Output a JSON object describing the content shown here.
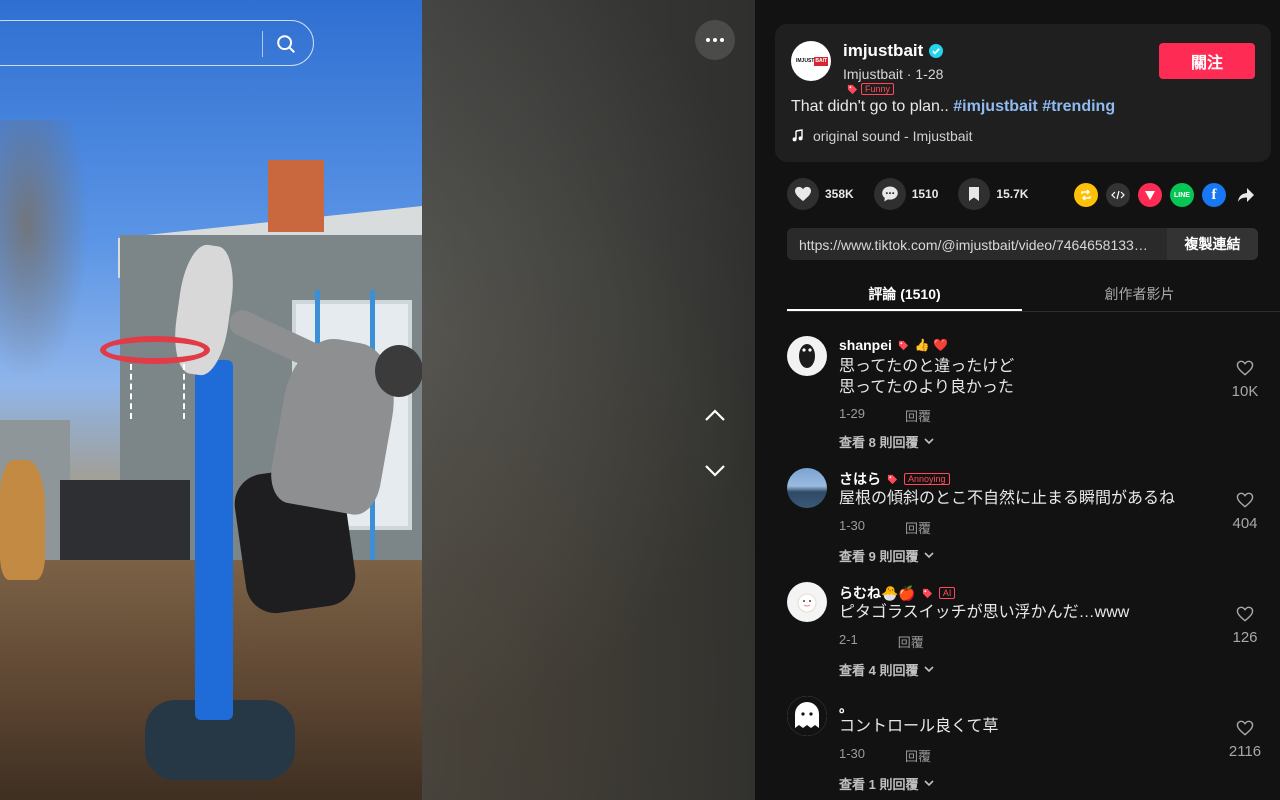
{
  "search": {
    "placeholder": ""
  },
  "post": {
    "username": "imjustbait",
    "display_name": "Imjustbait",
    "date": "1-28",
    "tag": "Funny",
    "follow_label": "關注",
    "caption_text": "That didn't go to plan.. ",
    "hashtags": [
      "#imjustbait",
      "#trending"
    ],
    "music": "original sound - Imjustbait",
    "avatar_logo": [
      "IMJUST",
      "BAIT"
    ]
  },
  "stats": {
    "likes": "358K",
    "comments": "1510",
    "saves": "15.7K"
  },
  "link": {
    "url": "https://www.tiktok.com/@imjustbait/video/7464658133…",
    "copy_label": "複製連結"
  },
  "tabs": [
    {
      "label": "評論 (1510)",
      "active": true
    },
    {
      "label": "創作者影片",
      "active": false
    }
  ],
  "reply_label": "回覆",
  "comments": [
    {
      "name": "shanpei",
      "emojis": "👍 ❤️",
      "tag": "",
      "text": "思ってたのと違ったけど\n思ってたのより良かった",
      "date": "1-29",
      "replies": "查看 8 則回覆",
      "likes": "10K",
      "avatar_color": "#f2f2f2"
    },
    {
      "name": "さはら",
      "emojis": "",
      "tag": "Annoying",
      "text": "屋根の傾斜のとこ不自然に止まる瞬間があるね",
      "date": "1-30",
      "replies": "查看 9 則回覆",
      "likes": "404",
      "avatar_color": "#5d7fa8"
    },
    {
      "name": "らむね🐣🍎",
      "emojis": "",
      "tag": "AI",
      "text": "ピタゴラスイッチが思い浮かんだ…www",
      "date": "2-1",
      "replies": "查看 4 則回覆",
      "likes": "126",
      "avatar_color": "#f4f4f4"
    },
    {
      "name": "。",
      "emojis": "",
      "tag": "",
      "text": "コントロール良くて草",
      "date": "1-30",
      "replies": "查看 1 則回覆",
      "likes": "2116",
      "avatar_color": "#ffffff"
    }
  ]
}
